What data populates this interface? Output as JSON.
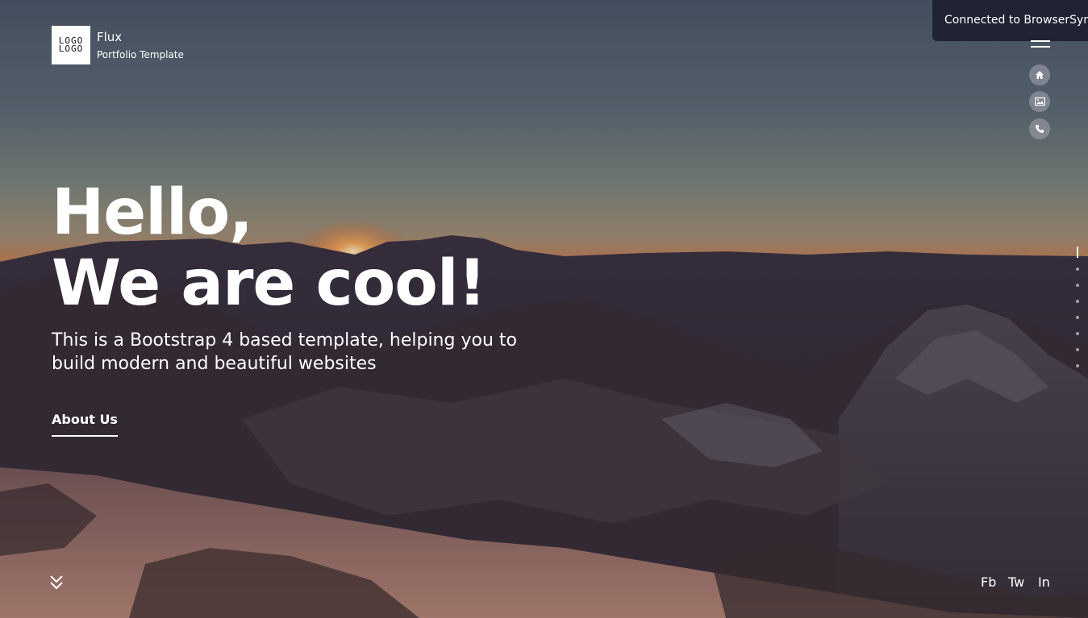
{
  "brand": {
    "logo_text": "LOGO\nLOGO",
    "name": "Flux",
    "tagline": "Portfolio Template"
  },
  "toast": {
    "text": "Connected to BrowserSync"
  },
  "nav": {
    "menu_icon": "hamburger-icon",
    "icons": [
      "home-icon",
      "image-icon",
      "phone-icon"
    ]
  },
  "hero": {
    "headline_line1": "Hello,",
    "headline_line2": "We are cool!",
    "subtitle": "This is a Bootstrap 4 based template, helping you to build modern and beautiful websites",
    "cta_label": "About Us"
  },
  "footer": {
    "scroll_icon": "double-chevron-down-icon",
    "social": [
      "Fb",
      "Tw",
      "In"
    ]
  },
  "section_dots": {
    "count": 8,
    "active_index": 0
  },
  "colors": {
    "toast_bg": "#1f2334",
    "text": "#ffffff"
  }
}
